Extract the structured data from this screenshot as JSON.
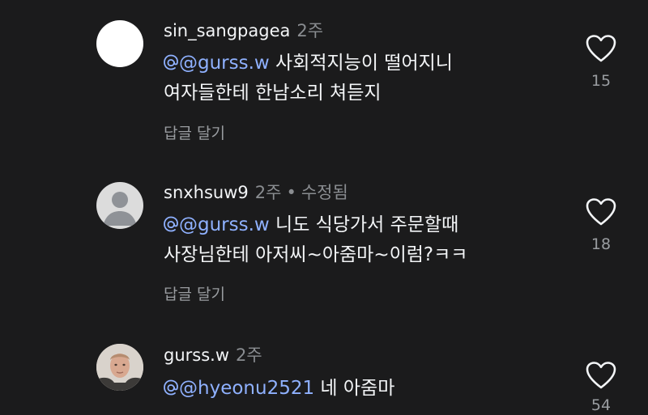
{
  "comments": [
    {
      "username": "sin_sangpagea",
      "time": "2주",
      "edited": "",
      "mention": "@gurss.w",
      "line1": " 사회적지능이 떨어지니",
      "line2": "여자들한테 한남소리 쳐듣지",
      "reply_label": "답글 달기",
      "likes": "15",
      "avatar": "blank-white-avatar"
    },
    {
      "username": "snxhsuw9",
      "time": "2주",
      "separator": "•",
      "edited": "수정됨",
      "mention": "@gurss.w",
      "line1": " 니도 식당가서 주문할때",
      "line2": "사장님한테 아저씨~아줌마~이럼?ㅋㅋ",
      "reply_label": "답글 달기",
      "likes": "18",
      "avatar": "default-person-avatar"
    },
    {
      "username": "gurss.w",
      "time": "2주",
      "edited": "",
      "mention": "@hyeonu2521",
      "line1": " 네 아줌마",
      "likes": "54",
      "avatar": "photo-avatar"
    }
  ],
  "colors": {
    "background": "#1b1b1c",
    "text": "#f3f5f7",
    "secondary": "#8a8d91",
    "mention": "#8fb1ff"
  },
  "icons": {
    "like": "heart-outline-icon",
    "mention_prefix": "threads-at-icon"
  }
}
